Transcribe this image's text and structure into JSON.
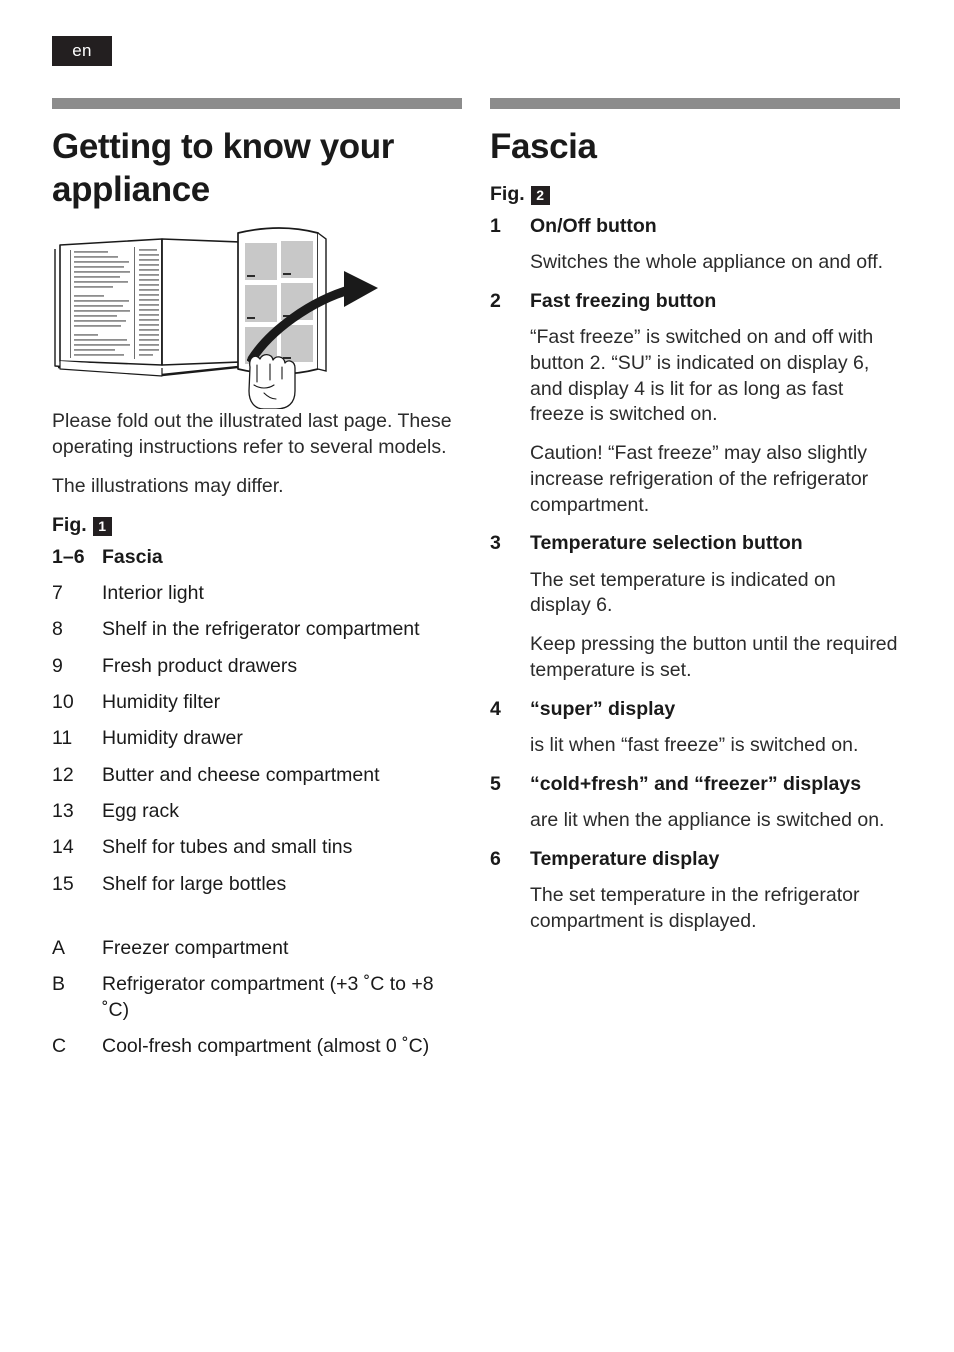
{
  "language_tab": {
    "label": "en"
  },
  "left_column": {
    "title": "Getting to know your appliance",
    "illustration_name": "fold-out-page-illustration",
    "intro_paragraph": "Please fold out the illustrated last page. These operating instructions refer to several models.",
    "note_paragraph": "The illustrations may differ.",
    "fig_label": "Fig.",
    "fig_number": "1",
    "items": [
      {
        "num": "1–6",
        "label": "Fascia",
        "bold": true
      },
      {
        "num": "7",
        "label": "Interior light",
        "bold": false
      },
      {
        "num": "8",
        "label": "Shelf in the refrigerator compartment",
        "bold": false
      },
      {
        "num": "9",
        "label": "Fresh product drawers",
        "bold": false
      },
      {
        "num": "10",
        "label": "Humidity filter",
        "bold": false
      },
      {
        "num": "11",
        "label": "Humidity drawer",
        "bold": false
      },
      {
        "num": "12",
        "label": "Butter and cheese compartment",
        "bold": false
      },
      {
        "num": "13",
        "label": "Egg rack",
        "bold": false
      },
      {
        "num": "14",
        "label": "Shelf for tubes and small tins",
        "bold": false
      },
      {
        "num": "15",
        "label": "Shelf for large bottles",
        "bold": false
      }
    ],
    "compartments": [
      {
        "num": "A",
        "label": "Freezer compartment",
        "bold": false
      },
      {
        "num": "B",
        "label": "Refrigerator compartment (+3 ˚C to +8 ˚C)",
        "bold": false
      },
      {
        "num": "C",
        "label": "Cool-fresh compartment (almost 0 ˚C)",
        "bold": false
      }
    ]
  },
  "right_column": {
    "title": "Fascia",
    "fig_label": "Fig.",
    "fig_number": "2",
    "entries": [
      {
        "num": "1",
        "label": "On/Off button",
        "paragraphs": [
          "Switches the whole appliance on and off."
        ]
      },
      {
        "num": "2",
        "label": "Fast freezing button",
        "paragraphs": [
          "“Fast freeze” is switched on and off with button 2. “SU” is indicated on display 6, and display 4 is lit for as long as fast freeze is switched on.",
          "Caution! “Fast freeze” may also slightly increase refrigeration of the refrigerator compartment."
        ]
      },
      {
        "num": "3",
        "label": "Temperature selection button",
        "paragraphs": [
          "The set temperature is indicated on display 6.",
          "Keep pressing the button until the required temperature is set."
        ]
      },
      {
        "num": "4",
        "label": "“super” display",
        "paragraphs": [
          "is lit when “fast freeze” is switched on."
        ]
      },
      {
        "num": "5",
        "label": "“cold+fresh” and “freezer” displays",
        "paragraphs": [
          "are lit when the appliance is switched on."
        ]
      },
      {
        "num": "6",
        "label": "Temperature display",
        "paragraphs": [
          "The set temperature in the refrigerator compartment is displayed."
        ]
      }
    ]
  },
  "colors": {
    "rule_gray": "#8c8c8c",
    "badge_black": "#231f20",
    "text": "#1a1a1a",
    "illustration_fill": "#c8c8c8"
  }
}
